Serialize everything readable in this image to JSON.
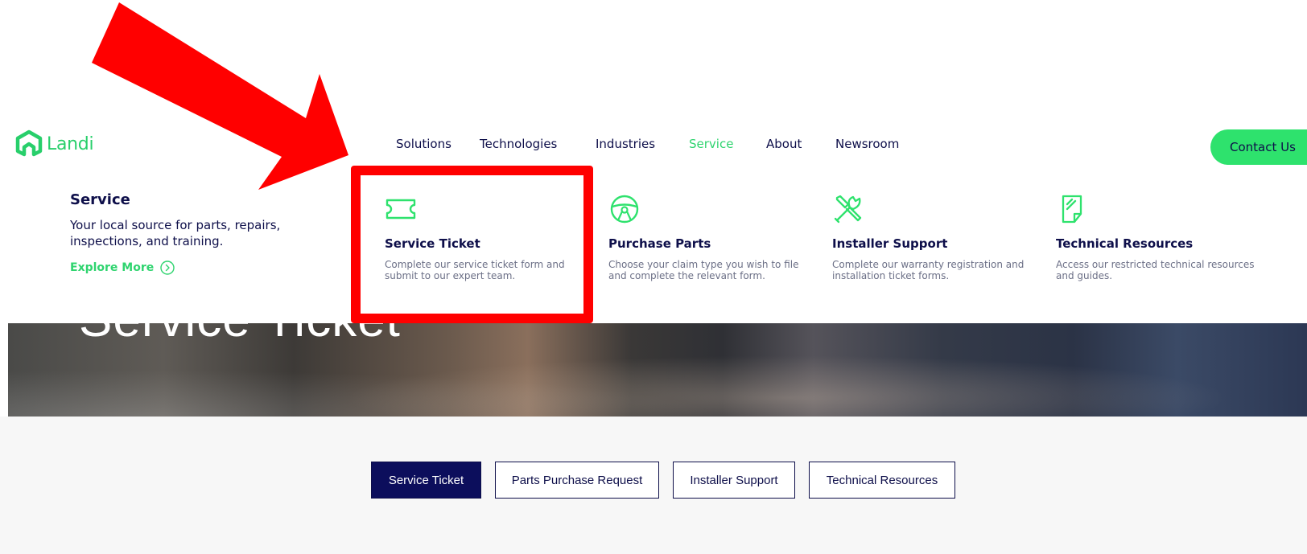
{
  "header": {
    "logo_text": "Landi",
    "nav": [
      {
        "label": "Solutions",
        "active": false
      },
      {
        "label": "Technologies",
        "active": false
      },
      {
        "label": "Industries",
        "active": false
      },
      {
        "label": "Service",
        "active": true
      },
      {
        "label": "About",
        "active": false
      },
      {
        "label": "Newsroom",
        "active": false
      }
    ],
    "contact_label": "Contact Us"
  },
  "mega_menu": {
    "intro": {
      "title": "Service",
      "text": "Your local source for parts, repairs, inspections, and training.",
      "explore_label": "Explore More"
    },
    "cards": [
      {
        "title": "Service Ticket",
        "description": "Complete our service ticket form and submit to our expert team.",
        "icon": "ticket-icon"
      },
      {
        "title": "Purchase Parts",
        "description": "Choose your claim type you wish to file and complete the relevant form.",
        "icon": "steering-wheel-icon"
      },
      {
        "title": "Installer Support",
        "description": "Complete our warranty registration and installation ticket forms.",
        "icon": "tools-icon"
      },
      {
        "title": "Technical Resources",
        "description": "Access our restricted technical resources and guides.",
        "icon": "document-icon"
      }
    ]
  },
  "hero": {
    "title": "Service Ticket"
  },
  "tabs": [
    {
      "label": "Service Ticket",
      "active": true
    },
    {
      "label": "Parts Purchase Request",
      "active": false
    },
    {
      "label": "Installer Support",
      "active": false
    },
    {
      "label": "Technical Resources",
      "active": false
    }
  ],
  "colors": {
    "brand_green": "#2ee26d",
    "navy": "#0e0f4a",
    "annotation_red": "#ff0000"
  }
}
